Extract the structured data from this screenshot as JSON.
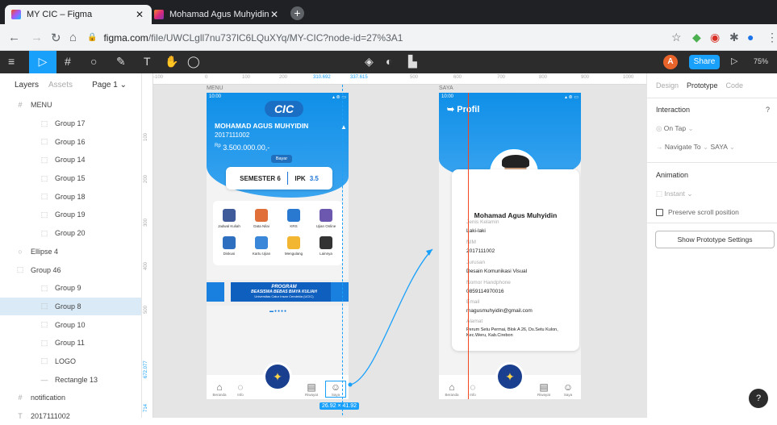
{
  "browser": {
    "tabs": [
      {
        "title": "MY CIC – Figma",
        "active": true
      },
      {
        "title": "Mohamad Agus Muhyidin (@m..."
      }
    ],
    "url_host": "figma.com",
    "url_path": "/file/UWCLgll7nu737lC6LQuXYq/MY-CIC?node-id=27%3A1"
  },
  "toolbar": {
    "avatar_letter": "A",
    "share_label": "Share",
    "zoom": "75%"
  },
  "layers_panel": {
    "tab_layers": "Layers",
    "tab_assets": "Assets",
    "page": "Page 1",
    "items": [
      {
        "label": "MENU",
        "indent": 0,
        "icon": "#"
      },
      {
        "label": "Group 17",
        "indent": 1,
        "icon": "⬚"
      },
      {
        "label": "Group 16",
        "indent": 1,
        "icon": "⬚"
      },
      {
        "label": "Group 14",
        "indent": 1,
        "icon": "⬚"
      },
      {
        "label": "Group 15",
        "indent": 1,
        "icon": "⬚"
      },
      {
        "label": "Group 18",
        "indent": 1,
        "icon": "⬚"
      },
      {
        "label": "Group 19",
        "indent": 1,
        "icon": "⬚"
      },
      {
        "label": "Group 20",
        "indent": 1,
        "icon": "⬚"
      },
      {
        "label": "Ellipse 4",
        "indent": 0,
        "icon": "○"
      },
      {
        "label": "Group 46",
        "indent": 0,
        "icon": "⬚"
      },
      {
        "label": "Group 9",
        "indent": 1,
        "icon": "⬚"
      },
      {
        "label": "Group 8",
        "indent": 1,
        "icon": "⬚",
        "selected": true
      },
      {
        "label": "Group 10",
        "indent": 1,
        "icon": "⬚"
      },
      {
        "label": "Group 11",
        "indent": 1,
        "icon": "⬚"
      },
      {
        "label": "LOGO",
        "indent": 1,
        "icon": "⬚"
      },
      {
        "label": "Rectangle 13",
        "indent": 1,
        "icon": "—"
      },
      {
        "label": "notification",
        "indent": 0,
        "icon": "#"
      },
      {
        "label": "2017111002",
        "indent": 0,
        "icon": "T"
      }
    ]
  },
  "canvas": {
    "ruler_top": [
      "-100",
      "0",
      "100",
      "200",
      "310.692",
      "337.615",
      "500",
      "600",
      "700",
      "800",
      "900",
      "1000"
    ],
    "ruler_left": [
      "100",
      "200",
      "300",
      "400",
      "500",
      "672.077",
      "714"
    ],
    "frame_menu_label": "MENU",
    "frame_saya_label": "SAYA",
    "dimension": "26.92 × 41.92"
  },
  "menu_screen": {
    "time": "10:00",
    "logo": "CIC",
    "name": "MOHAMAD AGUS MUHYIDIN",
    "nim": "2017111002",
    "currency": "Rp",
    "balance": "3.500.000.00,-",
    "pay_button": "Bayar",
    "semester_label": "SEMESTER 6",
    "ipk_label": "IPK",
    "ipk_value": "3.5",
    "menu_items": [
      "Jadwal Kuliah",
      "Data Nilai",
      "KRS",
      "Ujian Online",
      "Diskusi",
      "Kartu Ujian",
      "Mengulang",
      "Lainnya"
    ],
    "banner_title": "PROGRAM",
    "banner_subtitle": "BEASISWA BEBAS BIAYA KULIAH",
    "banner_org": "Universitas Catur Insan Cendekia (UCIC)",
    "nav": [
      "Beranda",
      "Info",
      "Riwayat",
      "Saya"
    ]
  },
  "profile_screen": {
    "time": "10:00",
    "title": "Profil",
    "name": "Mohamad Agus Muhyidin",
    "fields": [
      {
        "label": "Jenis Kelamin",
        "value": "Laki-laki"
      },
      {
        "label": "NIM",
        "value": "2017111002"
      },
      {
        "label": "Jurusan",
        "value": "Desain Komunikasi Visual"
      },
      {
        "label": "Nomor Handphone",
        "value": "0859114970016"
      },
      {
        "label": "Email",
        "value": "magusmuhyidin@gmail.com"
      },
      {
        "label": "Alamat",
        "value": "Perum Setu Permai, Blok A 26, Ds.Setu Kulon, Kec.Weru, Kab.Cirebon"
      }
    ],
    "nav": [
      "Beranda",
      "Info",
      "Riwayat",
      "Saya"
    ]
  },
  "properties_panel": {
    "tabs": [
      "Design",
      "Prototype",
      "Code"
    ],
    "interaction_title": "Interaction",
    "trigger": "On Tap",
    "action": "Navigate To",
    "destination": "SAYA",
    "animation_title": "Animation",
    "animation": "Instant",
    "preserve_scroll": "Preserve scroll position",
    "show_settings": "Show Prototype Settings"
  },
  "help_label": "?"
}
